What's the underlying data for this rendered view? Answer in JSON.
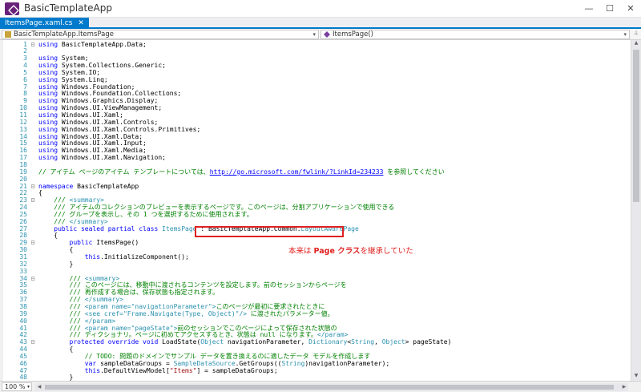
{
  "window": {
    "title": "BasicTemplateApp",
    "minimize_glyph": "—",
    "maximize_glyph": "☐",
    "close_glyph": "✕"
  },
  "tabs": [
    {
      "label": "ItemsPage.xaml.cs",
      "close_glyph": "✕",
      "active": true
    }
  ],
  "navigation": {
    "class_dropdown": "BasicTemplateApp.ItemsPage",
    "member_dropdown": "ItemsPage()",
    "arrow_glyph": "▾",
    "split_glyph": "⊥"
  },
  "editor": {
    "zoom": "100 %",
    "zoom_arrow": "▾",
    "scroll_up": "▲",
    "scroll_down": "▼",
    "scroll_left": "◀",
    "scroll_right": "▶",
    "lines": [
      {
        "n": "1",
        "fold": "⊟",
        "segs": [
          {
            "t": "using",
            "c": "kw"
          },
          {
            "t": " BasicTemplateApp.Data;"
          }
        ]
      },
      {
        "n": "2",
        "segs": []
      },
      {
        "n": "3",
        "segs": [
          {
            "t": "using",
            "c": "kw"
          },
          {
            "t": " System;"
          }
        ]
      },
      {
        "n": "4",
        "segs": [
          {
            "t": "using",
            "c": "kw"
          },
          {
            "t": " System.Collections.Generic;"
          }
        ]
      },
      {
        "n": "5",
        "segs": [
          {
            "t": "using",
            "c": "kw"
          },
          {
            "t": " System.IO;"
          }
        ]
      },
      {
        "n": "6",
        "segs": [
          {
            "t": "using",
            "c": "kw"
          },
          {
            "t": " System.Linq;"
          }
        ]
      },
      {
        "n": "7",
        "segs": [
          {
            "t": "using",
            "c": "kw"
          },
          {
            "t": " Windows.Foundation;"
          }
        ]
      },
      {
        "n": "8",
        "segs": [
          {
            "t": "using",
            "c": "kw"
          },
          {
            "t": " Windows.Foundation.Collections;"
          }
        ]
      },
      {
        "n": "9",
        "segs": [
          {
            "t": "using",
            "c": "kw"
          },
          {
            "t": " Windows.Graphics.Display;"
          }
        ]
      },
      {
        "n": "10",
        "segs": [
          {
            "t": "using",
            "c": "kw"
          },
          {
            "t": " Windows.UI.ViewManagement;"
          }
        ]
      },
      {
        "n": "11",
        "segs": [
          {
            "t": "using",
            "c": "kw"
          },
          {
            "t": " Windows.UI.Xaml;"
          }
        ]
      },
      {
        "n": "12",
        "segs": [
          {
            "t": "using",
            "c": "kw"
          },
          {
            "t": " Windows.UI.Xaml.Controls;"
          }
        ]
      },
      {
        "n": "13",
        "segs": [
          {
            "t": "using",
            "c": "kw"
          },
          {
            "t": " Windows.UI.Xaml.Controls.Primitives;"
          }
        ]
      },
      {
        "n": "14",
        "segs": [
          {
            "t": "using",
            "c": "kw"
          },
          {
            "t": " Windows.UI.Xaml.Data;"
          }
        ]
      },
      {
        "n": "15",
        "segs": [
          {
            "t": "using",
            "c": "kw"
          },
          {
            "t": " Windows.UI.Xaml.Input;"
          }
        ]
      },
      {
        "n": "16",
        "segs": [
          {
            "t": "using",
            "c": "kw"
          },
          {
            "t": " Windows.UI.Xaml.Media;"
          }
        ]
      },
      {
        "n": "17",
        "segs": [
          {
            "t": "using",
            "c": "kw"
          },
          {
            "t": " Windows.UI.Xaml.Navigation;"
          }
        ]
      },
      {
        "n": "18",
        "segs": []
      },
      {
        "n": "19",
        "segs": [
          {
            "t": "// アイテム ページのアイテム テンプレートについては、",
            "c": "cm"
          },
          {
            "t": "http://go.microsoft.com/fwlink/?LinkId=234233",
            "c": "lk"
          },
          {
            "t": " を参照してください",
            "c": "cm"
          }
        ]
      },
      {
        "n": "20",
        "segs": []
      },
      {
        "n": "21",
        "fold": "⊟",
        "segs": [
          {
            "t": "namespace",
            "c": "kw"
          },
          {
            "t": " BasicTemplateApp"
          }
        ]
      },
      {
        "n": "22",
        "segs": [
          {
            "t": "{"
          }
        ]
      },
      {
        "n": "23",
        "fold": "⊟",
        "segs": [
          {
            "t": "    /// ",
            "c": "cm"
          },
          {
            "t": "<summary>",
            "c": "ty"
          }
        ]
      },
      {
        "n": "24",
        "segs": [
          {
            "t": "    /// アイテムのコレクションのプレビューを表示するページです。このページは、分割アプリケーションで使用できる",
            "c": "cm"
          }
        ]
      },
      {
        "n": "25",
        "segs": [
          {
            "t": "    /// グループを表示し、その 1 つを選択するために使用されます。",
            "c": "cm"
          }
        ]
      },
      {
        "n": "26",
        "segs": [
          {
            "t": "    /// ",
            "c": "cm"
          },
          {
            "t": "</summary>",
            "c": "ty"
          }
        ]
      },
      {
        "n": "27",
        "segs": [
          {
            "t": "    "
          },
          {
            "t": "public sealed partial class",
            "c": "kw"
          },
          {
            "t": " "
          },
          {
            "t": "ItemsPage",
            "c": "ty"
          },
          {
            "t": " : BasicTemplateApp.Common."
          },
          {
            "t": "LayoutAwarePage",
            "c": "ty"
          }
        ]
      },
      {
        "n": "28",
        "segs": [
          {
            "t": "    {"
          }
        ]
      },
      {
        "n": "29",
        "fold": "⊟",
        "segs": [
          {
            "t": "        "
          },
          {
            "t": "public",
            "c": "kw"
          },
          {
            "t": " ItemsPage()"
          }
        ]
      },
      {
        "n": "30",
        "segs": [
          {
            "t": "        {"
          }
        ]
      },
      {
        "n": "31",
        "segs": [
          {
            "t": "            "
          },
          {
            "t": "this",
            "c": "kw"
          },
          {
            "t": ".InitializeComponent();"
          }
        ]
      },
      {
        "n": "32",
        "segs": [
          {
            "t": "        }"
          }
        ]
      },
      {
        "n": "33",
        "segs": []
      },
      {
        "n": "34",
        "fold": "⊟",
        "segs": [
          {
            "t": "        /// ",
            "c": "cm"
          },
          {
            "t": "<summary>",
            "c": "ty"
          }
        ]
      },
      {
        "n": "35",
        "segs": [
          {
            "t": "        /// このページには、移動中に渡されるコンテンツを設定します。前のセッションからページを",
            "c": "cm"
          }
        ]
      },
      {
        "n": "36",
        "segs": [
          {
            "t": "        /// 再作成する場合は、保存状態も指定されます。",
            "c": "cm"
          }
        ]
      },
      {
        "n": "37",
        "segs": [
          {
            "t": "        /// ",
            "c": "cm"
          },
          {
            "t": "</summary>",
            "c": "ty"
          }
        ]
      },
      {
        "n": "38",
        "segs": [
          {
            "t": "        /// ",
            "c": "cm"
          },
          {
            "t": "<param name=\"navigationParameter\">",
            "c": "ty"
          },
          {
            "t": "このページが最初に要求されたときに",
            "c": "cm"
          }
        ]
      },
      {
        "n": "39",
        "segs": [
          {
            "t": "        /// ",
            "c": "cm"
          },
          {
            "t": "<see cref=\"Frame.Navigate(Type, Object)\"/>",
            "c": "ty"
          },
          {
            "t": " に渡されたパラメーター値。",
            "c": "cm"
          }
        ]
      },
      {
        "n": "40",
        "segs": [
          {
            "t": "        /// ",
            "c": "cm"
          },
          {
            "t": "</param>",
            "c": "ty"
          }
        ]
      },
      {
        "n": "41",
        "segs": [
          {
            "t": "        /// ",
            "c": "cm"
          },
          {
            "t": "<param name=\"pageState\">",
            "c": "ty"
          },
          {
            "t": "前のセッションでこのページによって保存された状態の",
            "c": "cm"
          }
        ]
      },
      {
        "n": "42",
        "segs": [
          {
            "t": "        /// ディクショナリ。ページに初めてアクセスするとき、状態は null になります。",
            "c": "cm"
          },
          {
            "t": "</param>",
            "c": "ty"
          }
        ]
      },
      {
        "n": "43",
        "fold": "⊟",
        "segs": [
          {
            "t": "        "
          },
          {
            "t": "protected override void",
            "c": "kw"
          },
          {
            "t": " LoadState("
          },
          {
            "t": "Object",
            "c": "ty"
          },
          {
            "t": " navigationParameter, "
          },
          {
            "t": "Dictionary",
            "c": "ty"
          },
          {
            "t": "<"
          },
          {
            "t": "String",
            "c": "ty"
          },
          {
            "t": ", "
          },
          {
            "t": "Object",
            "c": "ty"
          },
          {
            "t": "> pageState)"
          }
        ]
      },
      {
        "n": "44",
        "segs": [
          {
            "t": "        {"
          }
        ]
      },
      {
        "n": "45",
        "segs": [
          {
            "t": "            // TODO: 問題のドメインでサンプル データを置き換えるのに適したデータ モデルを作成します",
            "c": "cm"
          }
        ]
      },
      {
        "n": "46",
        "segs": [
          {
            "t": "            "
          },
          {
            "t": "var",
            "c": "kw"
          },
          {
            "t": " sampleDataGroups = "
          },
          {
            "t": "SampleDataSource",
            "c": "ty"
          },
          {
            "t": ".GetGroups(("
          },
          {
            "t": "String",
            "c": "ty"
          },
          {
            "t": ")navigationParameter);"
          }
        ]
      },
      {
        "n": "47",
        "segs": [
          {
            "t": "            "
          },
          {
            "t": "this",
            "c": "kw"
          },
          {
            "t": ".DefaultViewModel["
          },
          {
            "t": "\"Items\"",
            "c": "st"
          },
          {
            "t": "] = sampleDataGroups;"
          }
        ]
      },
      {
        "n": "48",
        "segs": [
          {
            "t": "        }"
          }
        ]
      }
    ]
  },
  "annotation": {
    "prefix": "本来は ",
    "bold": "Page クラス",
    "suffix": "を継承していた",
    "color": "#e02020"
  },
  "colors": {
    "accent": "#007acc",
    "keyword": "#0000ff",
    "comment": "#008000",
    "type": "#2b91af",
    "line_number": "#2b91af"
  }
}
